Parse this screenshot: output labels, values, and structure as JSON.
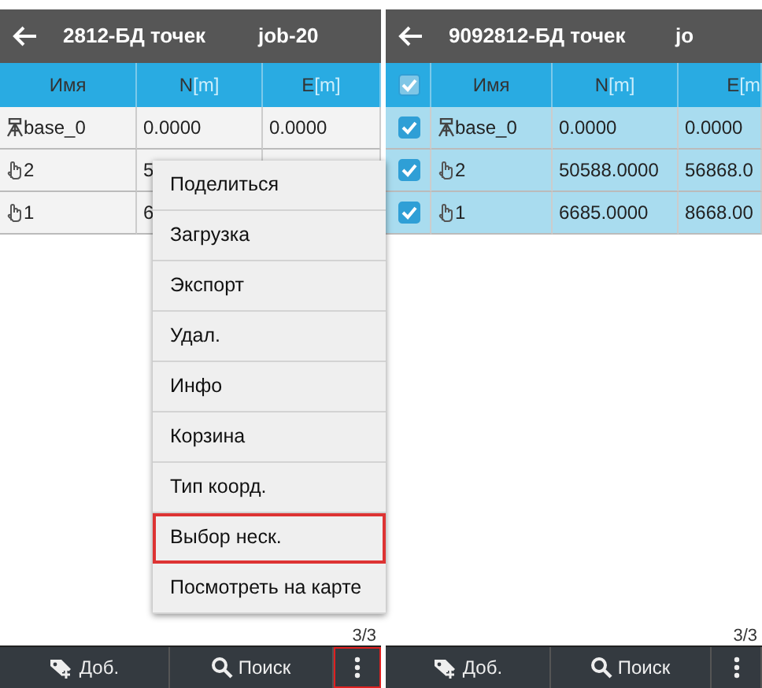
{
  "panels": [
    {
      "header": {
        "title": "2812-БД точек",
        "job": "job-20"
      },
      "columns": [
        {
          "name": "Имя"
        },
        {
          "name": "N",
          "unit": "[m]"
        },
        {
          "name": "E",
          "unit": "[m]"
        }
      ],
      "rows": [
        {
          "kind": "base",
          "name": "base_0",
          "n": "0.0000",
          "e": "0.0000"
        },
        {
          "kind": "point",
          "name": "2",
          "n": "5"
        },
        {
          "kind": "point",
          "name": "1",
          "n": "6"
        }
      ],
      "count": "3/3",
      "toolbar": [
        {
          "kind": "add",
          "label": "Доб.",
          "highlighted": false
        },
        {
          "kind": "search",
          "label": "Поиск",
          "highlighted": false
        },
        {
          "kind": "more",
          "highlighted": true
        }
      ],
      "menu": [
        {
          "label": "Поделиться",
          "highlighted": false
        },
        {
          "label": "Загрузка",
          "highlighted": false
        },
        {
          "label": "Экспорт",
          "highlighted": false
        },
        {
          "label": "Удал.",
          "highlighted": false
        },
        {
          "label": "Инфо",
          "highlighted": false
        },
        {
          "label": "Корзина",
          "highlighted": false
        },
        {
          "label": "Тип коорд.",
          "highlighted": false
        },
        {
          "label": "Выбор неск.",
          "highlighted": true
        },
        {
          "label": "Посмотреть на карте",
          "highlighted": false
        }
      ]
    },
    {
      "header": {
        "title": "9092812-БД точек",
        "job": "jo"
      },
      "columns": [
        {
          "name": "Имя"
        },
        {
          "name": "N",
          "unit": "[m]"
        },
        {
          "name": "E",
          "unit": "[m"
        }
      ],
      "header_checked": true,
      "rows": [
        {
          "kind": "base",
          "name": "base_0",
          "n": "0.0000",
          "e": "0.0000",
          "checked": true
        },
        {
          "kind": "point",
          "name": "2",
          "n": "50588.0000",
          "e": "56868.0",
          "checked": true
        },
        {
          "kind": "point",
          "name": "1",
          "n": "6685.0000",
          "e": "8668.00",
          "checked": true
        }
      ],
      "count": "3/3",
      "toolbar": [
        {
          "kind": "add",
          "label": "Доб.",
          "highlighted": false
        },
        {
          "kind": "search",
          "label": "Поиск",
          "highlighted": false
        },
        {
          "kind": "more",
          "highlighted": false
        }
      ]
    }
  ]
}
